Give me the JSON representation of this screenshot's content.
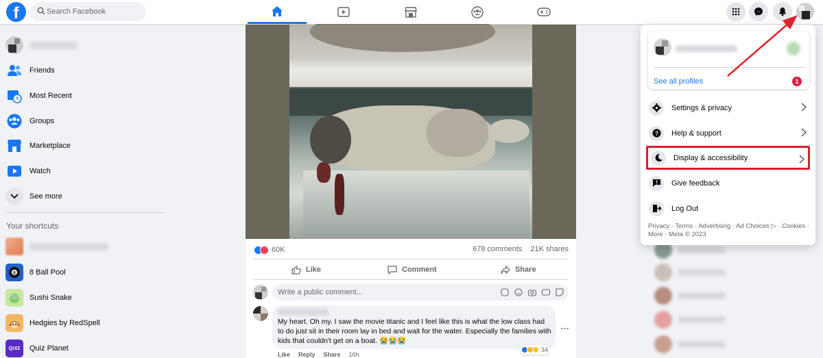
{
  "topbar": {
    "logo": "f",
    "search_placeholder": "Search Facebook",
    "nav_tabs": [
      "home-icon",
      "watch-icon",
      "marketplace-icon",
      "groups-icon",
      "gaming-icon"
    ],
    "active_tab": "home-icon",
    "right_buttons": [
      "menu-grid-icon",
      "messenger-icon",
      "notifications-icon"
    ]
  },
  "sidebar": {
    "items": [
      {
        "label": "Friends",
        "icon": "friends-icon"
      },
      {
        "label": "Most Recent",
        "icon": "most-recent-icon"
      },
      {
        "label": "Groups",
        "icon": "groups-icon"
      },
      {
        "label": "Marketplace",
        "icon": "marketplace-icon"
      },
      {
        "label": "Watch",
        "icon": "watch-icon"
      },
      {
        "label": "See more",
        "icon": "chevron-down-icon"
      }
    ],
    "shortcuts_title": "Your shortcuts",
    "shortcuts": [
      {
        "label": "8 Ball Pool",
        "icon": "8-ball-pool-icon"
      },
      {
        "label": "Sushi Snake",
        "icon": "sushi-snake-icon"
      },
      {
        "label": "Hedgies by RedSpell",
        "icon": "hedgies-icon"
      },
      {
        "label": "Quiz Planet",
        "icon": "quiz-planet-icon",
        "icon_text": "QUIZ"
      }
    ]
  },
  "post": {
    "reaction_count": "60K",
    "comments": "678 comments",
    "shares": "21K shares",
    "actions": {
      "like": "Like",
      "comment": "Comment",
      "share": "Share"
    },
    "comment_placeholder": "Write a public comment...",
    "comment": {
      "text": "My heart. Oh my. I saw the movie titanic and I feel like this is what the low class had to do just sit in their room lay in bed and wait for the water. Especially the families with kids that couldn't get on a boat. 😭😭😭",
      "reaction_count": "34",
      "actions": {
        "like": "Like",
        "reply": "Reply",
        "share": "Share",
        "time": "16h"
      }
    }
  },
  "dropdown": {
    "see_all_profiles": "See all profiles",
    "badge": "1",
    "items": [
      {
        "label": "Settings & privacy",
        "icon": "gear-icon",
        "chevron": true
      },
      {
        "label": "Help & support",
        "icon": "help-icon",
        "chevron": true
      },
      {
        "label": "Display & accessibility",
        "icon": "moon-icon",
        "chevron": true,
        "highlighted": true
      },
      {
        "label": "Give feedback",
        "icon": "feedback-icon",
        "chevron": false
      },
      {
        "label": "Log Out",
        "icon": "logout-icon",
        "chevron": false
      }
    ],
    "footer": "Privacy · Terms · Advertising · Ad Choices ▷ · Cookies · More · Meta © 2023"
  },
  "colors": {
    "brand": "#1877f2",
    "highlight_box": "#d91f2b",
    "arrow": "#e0232a",
    "badge": "#e41e3f"
  }
}
